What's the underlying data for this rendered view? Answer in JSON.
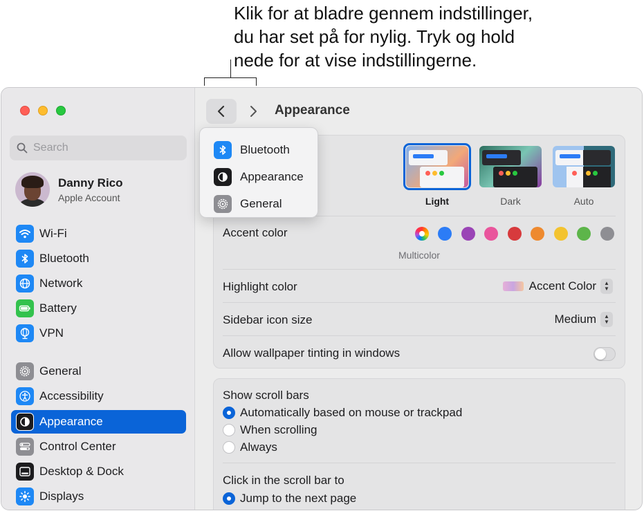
{
  "callout": {
    "line1": "Klik for at bladre gennem indstillinger,",
    "line2": "du har set på for nylig. Tryk og hold",
    "line3": "nede for at vise indstillingerne."
  },
  "search": {
    "placeholder": "Search"
  },
  "account": {
    "name": "Danny Rico",
    "subtitle": "Apple Account"
  },
  "sidebar": {
    "items": [
      {
        "label": "Wi-Fi",
        "icon": "wifi-icon",
        "color": "#1e88f5"
      },
      {
        "label": "Bluetooth",
        "icon": "bluetooth-icon",
        "color": "#1e88f5"
      },
      {
        "label": "Network",
        "icon": "globe-icon",
        "color": "#1e88f5"
      },
      {
        "label": "Battery",
        "icon": "battery-icon",
        "color": "#33c24d"
      },
      {
        "label": "VPN",
        "icon": "vpn-icon",
        "color": "#1e88f5"
      },
      {
        "label": "General",
        "icon": "gear-icon",
        "color": "#8e8e93"
      },
      {
        "label": "Accessibility",
        "icon": "accessibility-icon",
        "color": "#1e88f5"
      },
      {
        "label": "Appearance",
        "icon": "appearance-icon",
        "color": "#1c1c1e",
        "selected": true
      },
      {
        "label": "Control Center",
        "icon": "control-center-icon",
        "color": "#8e8e93"
      },
      {
        "label": "Desktop & Dock",
        "icon": "dock-icon",
        "color": "#1c1c1e"
      },
      {
        "label": "Displays",
        "icon": "sun-icon",
        "color": "#1e88f5"
      }
    ]
  },
  "toolbar": {
    "title": "Appearance"
  },
  "history_menu": {
    "items": [
      {
        "label": "Bluetooth",
        "icon": "bluetooth-icon"
      },
      {
        "label": "Appearance",
        "icon": "appearance-icon"
      },
      {
        "label": "General",
        "icon": "gear-icon"
      }
    ]
  },
  "appearance": {
    "options": [
      {
        "label": "Light",
        "selected": true
      },
      {
        "label": "Dark",
        "selected": false
      },
      {
        "label": "Auto",
        "selected": false
      }
    ]
  },
  "accent": {
    "label": "Accent color",
    "selected_caption": "Multicolor",
    "colors": [
      "multicolor",
      "#2c7cf6",
      "#9a44b6",
      "#e9559c",
      "#d73a3d",
      "#ee8a2f",
      "#f3c32f",
      "#5db54a",
      "#8e8e93"
    ]
  },
  "highlight": {
    "label": "Highlight color",
    "value": "Accent Color"
  },
  "sidebar_icon_size": {
    "label": "Sidebar icon size",
    "value": "Medium"
  },
  "wallpaper_tinting": {
    "label": "Allow wallpaper tinting in windows",
    "enabled": false
  },
  "scroll_bars": {
    "label": "Show scroll bars",
    "options": [
      {
        "label": "Automatically based on mouse or trackpad",
        "selected": true
      },
      {
        "label": "When scrolling",
        "selected": false
      },
      {
        "label": "Always",
        "selected": false
      }
    ]
  },
  "scroll_click": {
    "label": "Click in the scroll bar to",
    "options": [
      {
        "label": "Jump to the next page",
        "selected": true
      }
    ]
  }
}
